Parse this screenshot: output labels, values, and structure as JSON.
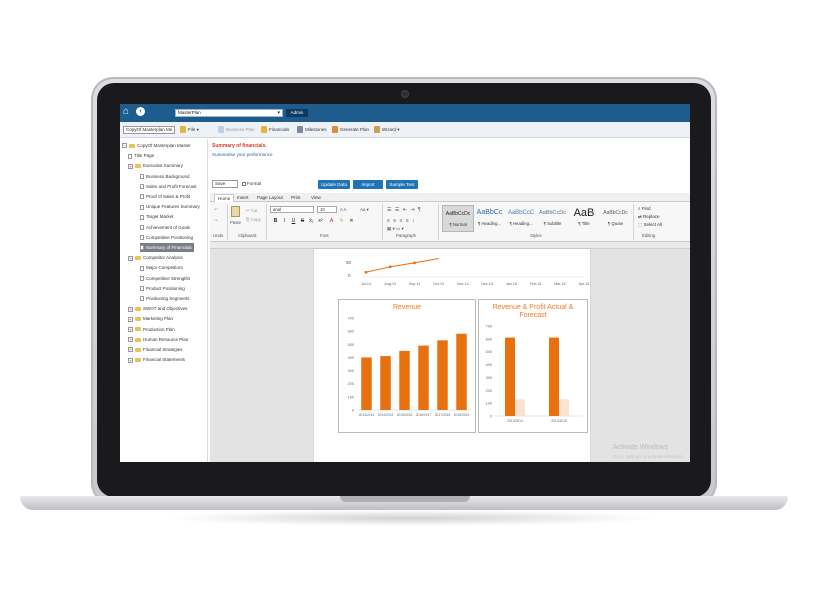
{
  "topbar": {
    "plan_selected": "MasterPlan",
    "admin_label": "Admin"
  },
  "toolbar": {
    "company_select": "CopyOf Masterplan Me",
    "items": [
      {
        "label": "File"
      },
      {
        "label": "Business Plan"
      },
      {
        "label": "Financials"
      },
      {
        "label": "Milestones"
      },
      {
        "label": "Generate Plan"
      },
      {
        "label": "Wizard"
      }
    ]
  },
  "sidebar": {
    "items": [
      {
        "label": "CopyOf Masterplan Master",
        "type": "root"
      },
      {
        "label": "Title Page",
        "type": "doc"
      },
      {
        "label": "Executive Summary",
        "type": "folder"
      },
      {
        "label": "Business Background",
        "type": "doc"
      },
      {
        "label": "Sales and Profit Forecast",
        "type": "doc"
      },
      {
        "label": "Proof of Sales & Profit",
        "type": "doc"
      },
      {
        "label": "Unique Features Summary",
        "type": "doc"
      },
      {
        "label": "Target Market",
        "type": "doc"
      },
      {
        "label": "Achievement of Goals",
        "type": "doc"
      },
      {
        "label": "Competitive Positioning",
        "type": "doc"
      },
      {
        "label": "Summary of Financials",
        "type": "doc",
        "selected": true
      },
      {
        "label": "Competitor Analysis",
        "type": "folder"
      },
      {
        "label": "Major Competitors",
        "type": "doc"
      },
      {
        "label": "Competitive Strengths",
        "type": "doc"
      },
      {
        "label": "Product Positioning",
        "type": "doc"
      },
      {
        "label": "Positioning Segments",
        "type": "doc"
      },
      {
        "label": "SWOT and Objectives",
        "type": "folder"
      },
      {
        "label": "Marketing Plan",
        "type": "folder"
      },
      {
        "label": "Production Plan",
        "type": "folder"
      },
      {
        "label": "Human Resource Plan",
        "type": "folder"
      },
      {
        "label": "Financial Strategies",
        "type": "folder"
      },
      {
        "label": "Financial Statements",
        "type": "folder"
      }
    ]
  },
  "main": {
    "section_title": "Summary of financials.",
    "section_sub": "Summarise your performance",
    "save_select": "Save",
    "format_label": "Format",
    "buttons": {
      "update": "Update Data",
      "import": "Import",
      "sample": "Sample Text"
    }
  },
  "ribbon": {
    "tabs": [
      "Home",
      "Insert",
      "Page Layout",
      "Print",
      "View"
    ],
    "groups": {
      "undo": "Undo",
      "clipboard": "Clipboard",
      "font": "Font",
      "paragraph": "Paragraph",
      "styles": "Styles",
      "editing": "Editing"
    },
    "clipboard": {
      "paste": "Paste",
      "cut": "Cut",
      "copy": "Copy"
    },
    "font_name": "arial",
    "font_size": "10",
    "format_buttons": [
      "B",
      "I",
      "U",
      "S",
      "x₂",
      "x²"
    ],
    "styles": [
      {
        "preview": "AaBbCcDc",
        "name": "¶ Normal"
      },
      {
        "preview": "AaBbCc",
        "name": "¶ Heading..."
      },
      {
        "preview": "AaBbCcC",
        "name": "¶ Heading..."
      },
      {
        "preview": "AaBbCcDc",
        "name": "¶ Subtitle"
      },
      {
        "preview": "AaB",
        "name": "¶ Title"
      },
      {
        "preview": "AaBbCcDc",
        "name": "¶ Quote"
      }
    ],
    "editing": {
      "find": "Find",
      "replace": "Replace",
      "select_all": "Select All"
    }
  },
  "watermark": {
    "line1": "Activate Windows",
    "line2": "Go to Settings to activate Windows."
  },
  "colors": {
    "topbar": "#1e5c8e",
    "accent_orange": "#e8700e",
    "light_orange": "#fbe1cf",
    "button_blue": "#1f74b7"
  },
  "chart_data": [
    {
      "type": "line",
      "title": "",
      "categories": [
        "Jul-14",
        "Aug-14",
        "Sep-14",
        "Oct-14",
        "Nov-14",
        "Dec-14",
        "Jan-15",
        "Feb-15",
        "Mar-15",
        "Apr-15"
      ],
      "visible_ticks": [
        "50",
        "0"
      ],
      "series": [
        {
          "values": [
            45,
            55,
            62,
            70
          ]
        }
      ]
    },
    {
      "type": "bar",
      "title": "Revenue",
      "categories": [
        "2013/2014",
        "2014/2015",
        "2015/2016",
        "2016/2017",
        "2017/2018",
        "2018/2019"
      ],
      "values": [
        400,
        410,
        450,
        490,
        530,
        580
      ],
      "ylim": [
        0,
        700
      ],
      "yticks": [
        "0",
        "100",
        "200",
        "300",
        "400",
        "500",
        "600",
        "700"
      ]
    },
    {
      "type": "bar",
      "title": "Revenue & Profit Actual & Forecast",
      "categories": [
        "2013/2014",
        "2014/2015"
      ],
      "series": [
        {
          "values": [
            610,
            610
          ],
          "color": "#e8700e"
        },
        {
          "values": [
            130,
            130
          ],
          "color": "#fbe1cf"
        }
      ],
      "ylim": [
        0,
        700
      ],
      "yticks": [
        "0",
        "100",
        "200",
        "300",
        "400",
        "500",
        "600",
        "700"
      ]
    }
  ]
}
